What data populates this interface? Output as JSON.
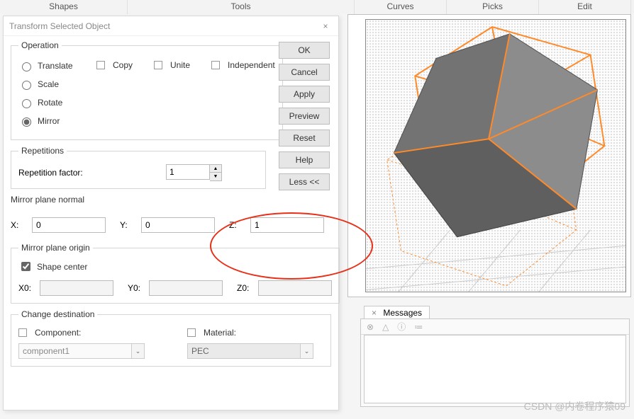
{
  "top_tabs": {
    "shapes": "Shapes",
    "tools": "Tools",
    "curves": "Curves",
    "picks": "Picks",
    "edit": "Edit"
  },
  "dialog": {
    "title": "Transform Selected Object",
    "operation": {
      "legend": "Operation",
      "translate": "Translate",
      "scale": "Scale",
      "rotate": "Rotate",
      "mirror": "Mirror",
      "selected": "mirror",
      "copy": "Copy",
      "unite": "Unite",
      "independent": "Independent"
    },
    "buttons": {
      "ok": "OK",
      "cancel": "Cancel",
      "apply": "Apply",
      "preview": "Preview",
      "reset": "Reset",
      "help": "Help",
      "less": "Less <<"
    },
    "repetitions": {
      "legend": "Repetitions",
      "factor_label": "Repetition factor:",
      "factor_value": "1"
    },
    "mirror_normal": {
      "label": "Mirror plane normal",
      "x_label": "X:",
      "x_value": "0",
      "y_label": "Y:",
      "y_value": "0",
      "z_label": "Z:",
      "z_value": "1"
    },
    "mirror_origin": {
      "legend": "Mirror plane origin",
      "shape_center": "Shape center",
      "shape_center_checked": true,
      "x0_label": "X0:",
      "x0_value": "",
      "y0_label": "Y0:",
      "y0_value": "",
      "z0_label": "Z0:",
      "z0_value": ""
    },
    "destination": {
      "legend": "Change destination",
      "component_label": "Component:",
      "component_value": "component1",
      "material_label": "Material:",
      "material_value": "PEC"
    }
  },
  "messages": {
    "tab": "Messages"
  },
  "watermark": "CSDN @内卷程序猿09"
}
